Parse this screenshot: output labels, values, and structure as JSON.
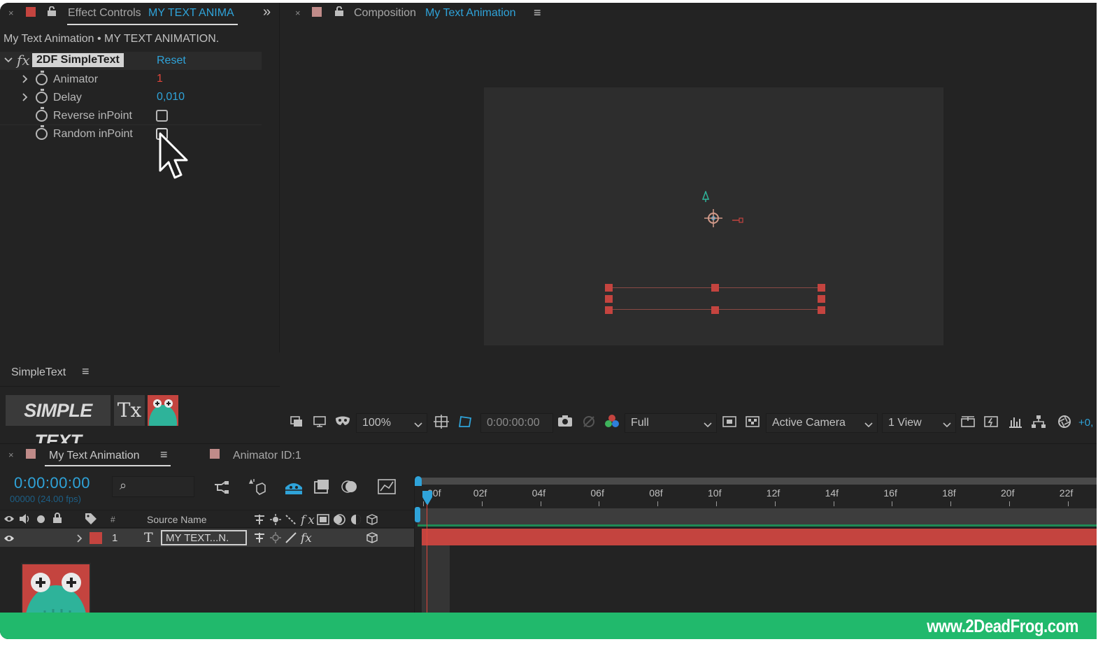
{
  "effect_controls": {
    "tab_close": "×",
    "tab_title": "Effect Controls",
    "tab_layer": "MY TEXT ANIMA",
    "expand": "»",
    "breadcrumb": "My Text Animation • MY TEXT ANIMATION.",
    "effect_fx": "fx",
    "effect_name": "2DF SimpleText",
    "reset": "Reset",
    "params": [
      {
        "label": "Animator",
        "value": "1"
      },
      {
        "label": "Delay",
        "value": "0,010"
      },
      {
        "label": "Reverse inPoint"
      },
      {
        "label": "Random inPoint"
      }
    ]
  },
  "composition": {
    "tab_close": "×",
    "tab_title": "Composition",
    "comp_name": "My Text Animation",
    "menu": "≡"
  },
  "simpletext": {
    "title": "SimpleText",
    "menu": "≡",
    "logo": "SIMPLE TEXT",
    "clear_icon_text": "Tx"
  },
  "comp_toolbar": {
    "zoom": "100%",
    "timecode": "0:00:00:00",
    "resolution": "Full",
    "camera": "Active Camera",
    "views": "1 View",
    "exposure": "+0,"
  },
  "timeline": {
    "tab_close": "×",
    "tab_title": "My Text Animation",
    "menu": "≡",
    "second_tab": "Animator ID:1",
    "timecode": "0:00:00:00",
    "frame_info": "00000 (24.00 fps)",
    "search_icon_text": "⌕",
    "col_hash": "#",
    "col_source": "Source Name",
    "layer": {
      "number": "1",
      "type": "T",
      "name": "MY TEXT...N."
    },
    "ruler": [
      "00f",
      "02f",
      "04f",
      "06f",
      "08f",
      "10f",
      "12f",
      "14f",
      "16f",
      "18f",
      "20f",
      "22f"
    ]
  },
  "footer": {
    "url": "www.2DeadFrog.com"
  }
}
